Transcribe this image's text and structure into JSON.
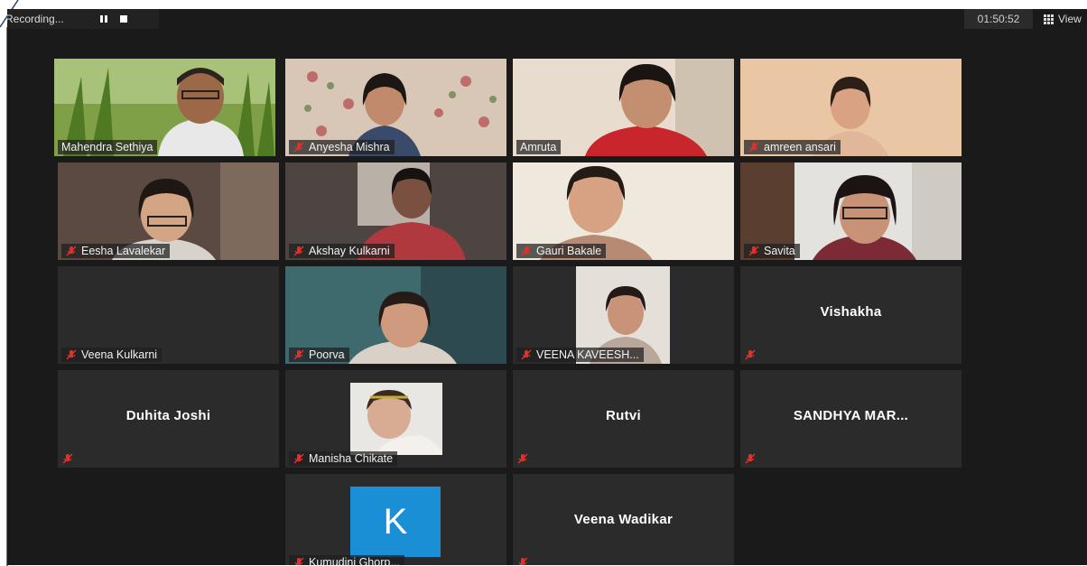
{
  "toolbar": {
    "recording_label": "Recording...",
    "pause_icon": "pause-icon",
    "stop_icon": "stop-icon",
    "timer": "01:50:52",
    "view_label": "View"
  },
  "participants": [
    {
      "name": "Mahendra Sethiya",
      "muted": false,
      "video": true,
      "active": true
    },
    {
      "name": "Anyesha Mishra",
      "muted": true,
      "video": true
    },
    {
      "name": "Amruta",
      "muted": false,
      "video": true
    },
    {
      "name": "amreen ansari",
      "muted": true,
      "video": true
    },
    {
      "name": "Eesha Lavalekar",
      "muted": true,
      "video": true
    },
    {
      "name": "Akshay Kulkarni",
      "muted": true,
      "video": true
    },
    {
      "name": "Gauri  Bakale",
      "muted": true,
      "video": true
    },
    {
      "name": "Savita",
      "muted": true,
      "video": true
    },
    {
      "name": "Veena Kulkarni",
      "muted": true,
      "video": false
    },
    {
      "name": "Poorva",
      "muted": true,
      "video": true
    },
    {
      "name": "VEENA KAVEESH...",
      "muted": true,
      "video": true
    },
    {
      "name": "Vishakha",
      "muted": true,
      "video": false
    },
    {
      "name": "Duhita Joshi",
      "muted": true,
      "video": false
    },
    {
      "name": "Manisha Chikate",
      "muted": true,
      "video": true
    },
    {
      "name": "Rutvi",
      "muted": true,
      "video": false
    },
    {
      "name": "SANDHYA  MAR...",
      "muted": true,
      "video": false
    },
    {
      "name": "Kumudini Ghorp...",
      "muted": true,
      "video": false,
      "avatar_letter": "K"
    },
    {
      "name": "Veena Wadikar",
      "muted": true,
      "video": false
    }
  ],
  "colors": {
    "active_speaker_outline": "#d8dc4a",
    "mute_red": "#e0312b",
    "avatar_blue": "#1b8fd6"
  }
}
